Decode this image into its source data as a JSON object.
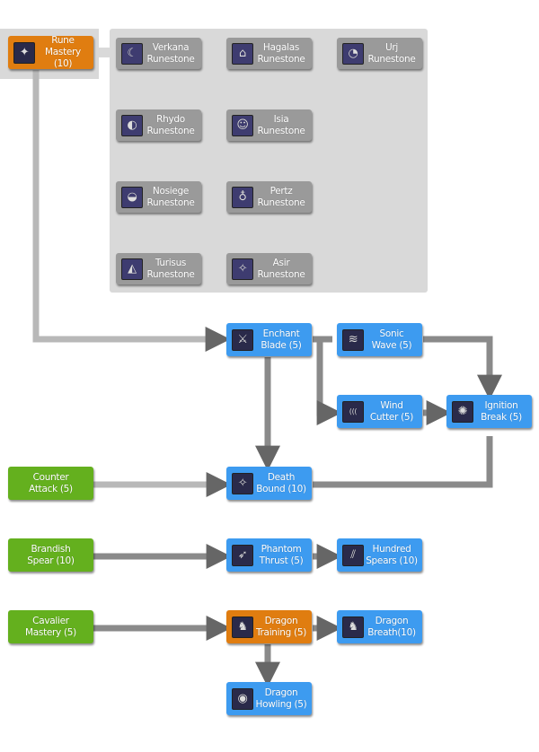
{
  "nodes": {
    "rune_mastery": {
      "l1": "Rune",
      "l2": "Mastery (10)",
      "color": "orange",
      "icon": "rune-icon"
    },
    "verkana": {
      "l1": "Verkana",
      "l2": "Runestone"
    },
    "hagalas": {
      "l1": "Hagalas",
      "l2": "Runestone"
    },
    "urj": {
      "l1": "Urj",
      "l2": "Runestone"
    },
    "rhydo": {
      "l1": "Rhydo",
      "l2": "Runestone"
    },
    "isia": {
      "l1": "Isia",
      "l2": "Runestone"
    },
    "nosiege": {
      "l1": "Nosiege",
      "l2": "Runestone"
    },
    "pertz": {
      "l1": "Pertz",
      "l2": "Runestone"
    },
    "turisus": {
      "l1": "Turisus",
      "l2": "Runestone"
    },
    "asir": {
      "l1": "Asir",
      "l2": "Runestone"
    },
    "enchant_blade": {
      "l1": "Enchant",
      "l2": "Blade (5)"
    },
    "sonic_wave": {
      "l1": "Sonic",
      "l2": "Wave (5)"
    },
    "wind_cutter": {
      "l1": "Wind",
      "l2": "Cutter (5)"
    },
    "ignition_break": {
      "l1": "Ignition",
      "l2": "Break (5)"
    },
    "death_bound": {
      "l1": "Death",
      "l2": "Bound (10)"
    },
    "counter_attack": {
      "l1": "Counter",
      "l2": "Attack (5)"
    },
    "brandish_spear": {
      "l1": "Brandish",
      "l2": "Spear (10)"
    },
    "phantom_thrust": {
      "l1": "Phantom",
      "l2": "Thrust (5)"
    },
    "hundred_spears": {
      "l1": "Hundred",
      "l2": "Spears (10)"
    },
    "cavalier_mastery": {
      "l1": "Cavalier",
      "l2": "Mastery (5)"
    },
    "dragon_training": {
      "l1": "Dragon",
      "l2": "Training (5)"
    },
    "dragon_breath": {
      "l1": "Dragon",
      "l2": "Breath(10)"
    },
    "dragon_howling": {
      "l1": "Dragon",
      "l2": "Howling (5)"
    }
  },
  "colors": {
    "blue": "#3d9bf0",
    "orange": "#e07d10",
    "green": "#64b01e",
    "gray": "#9a9a9a",
    "panel": "#d9d9d9"
  }
}
